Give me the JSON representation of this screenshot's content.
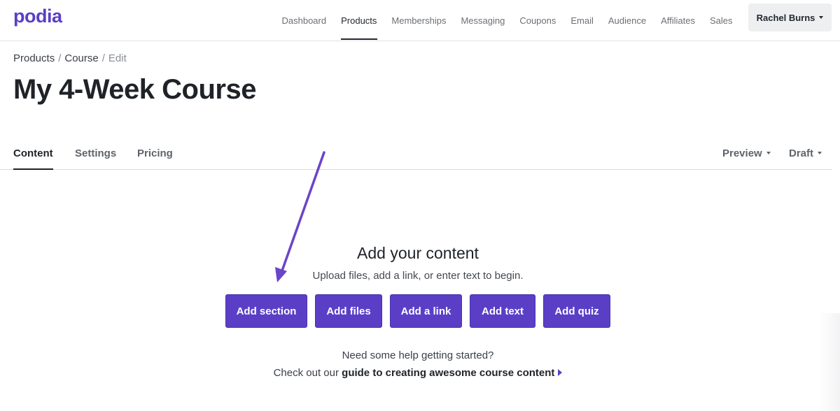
{
  "app": {
    "logo": "podia",
    "brand_color": "#5a3fc6"
  },
  "nav": {
    "items": [
      {
        "label": "Dashboard",
        "active": false
      },
      {
        "label": "Products",
        "active": true
      },
      {
        "label": "Memberships",
        "active": false
      },
      {
        "label": "Messaging",
        "active": false
      },
      {
        "label": "Coupons",
        "active": false
      },
      {
        "label": "Email",
        "active": false
      },
      {
        "label": "Audience",
        "active": false
      },
      {
        "label": "Affiliates",
        "active": false
      },
      {
        "label": "Sales",
        "active": false
      }
    ],
    "user": "Rachel Burns"
  },
  "breadcrumb": {
    "items": [
      "Products",
      "Course"
    ],
    "separator": "/",
    "current": "Edit"
  },
  "page": {
    "title": "My 4-Week Course"
  },
  "tabs": {
    "items": [
      "Content",
      "Settings",
      "Pricing"
    ],
    "active": "Content",
    "preview": "Preview",
    "status": "Draft"
  },
  "empty_state": {
    "title": "Add your content",
    "subtitle": "Upload files, add a link, or enter text to begin.",
    "buttons": [
      "Add section",
      "Add files",
      "Add a link",
      "Add text",
      "Add quiz"
    ],
    "help_question": "Need some help getting started?",
    "help_prefix": "Check out our",
    "help_link": "guide to creating awesome course content"
  },
  "annotation": {
    "arrow_color": "#6a44c9",
    "points_to": "Add section"
  }
}
